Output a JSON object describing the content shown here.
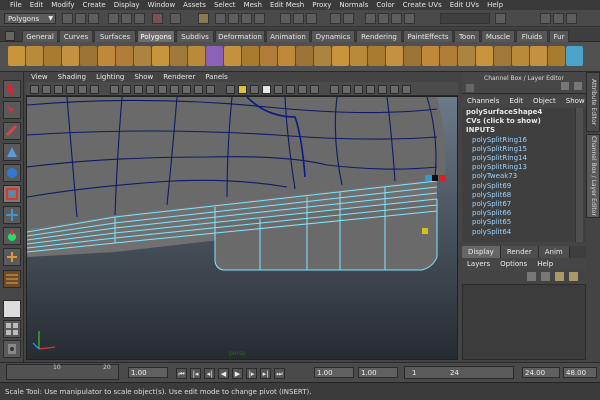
{
  "menubar": {
    "items": [
      "File",
      "Edit",
      "Modify",
      "Create",
      "Display",
      "Window",
      "Assets",
      "Select",
      "Mesh",
      "Edit Mesh",
      "Proxy",
      "Normals",
      "Color",
      "Create UVs",
      "Edit UVs",
      "Help"
    ]
  },
  "status_line": {
    "mode_selector": "Polygons"
  },
  "shelf_tabs": [
    {
      "label": "General",
      "active": false
    },
    {
      "label": "Curves",
      "active": false
    },
    {
      "label": "Surfaces",
      "active": false
    },
    {
      "label": "Polygons",
      "active": true
    },
    {
      "label": "Subdivs",
      "active": false
    },
    {
      "label": "Deformation",
      "active": false
    },
    {
      "label": "Animation",
      "active": false
    },
    {
      "label": "Dynamics",
      "active": false
    },
    {
      "label": "Rendering",
      "active": false
    },
    {
      "label": "PaintEffects",
      "active": false
    },
    {
      "label": "Toon",
      "active": false
    },
    {
      "label": "Muscle",
      "active": false
    },
    {
      "label": "Fluids",
      "active": false
    },
    {
      "label": "Fur",
      "active": false
    }
  ],
  "panel_menu": [
    "View",
    "Shading",
    "Lighting",
    "Show",
    "Renderer",
    "Panels"
  ],
  "channel_box": {
    "title": "Channel Box / Layer Editor",
    "menu": [
      "Channels",
      "Edit",
      "Object",
      "Show"
    ],
    "lines": [
      {
        "text": "polySurfaceShape4",
        "type": "head"
      },
      {
        "text": "CVs (click to show)",
        "type": "head"
      },
      {
        "text": "INPUTS",
        "type": "head"
      },
      {
        "text": "polySplitRing16",
        "type": "indent"
      },
      {
        "text": "polySplitRing15",
        "type": "indent"
      },
      {
        "text": "polySplitRing14",
        "type": "indent"
      },
      {
        "text": "polySplitRing13",
        "type": "indent"
      },
      {
        "text": "polyTweak73",
        "type": "indent"
      },
      {
        "text": "polySplit69",
        "type": "indent"
      },
      {
        "text": "polySplit68",
        "type": "indent"
      },
      {
        "text": "polySplit67",
        "type": "indent"
      },
      {
        "text": "polySplit66",
        "type": "indent"
      },
      {
        "text": "polySplit65",
        "type": "indent"
      },
      {
        "text": "polySplit64",
        "type": "indent"
      }
    ]
  },
  "side_tabs": {
    "attribute_editor": "Attribute Editor",
    "channel_box": "Channel Box / Layer Editor"
  },
  "layer_editor": {
    "tabs": [
      {
        "label": "Display",
        "active": true
      },
      {
        "label": "Render",
        "active": false
      },
      {
        "label": "Anim",
        "active": false
      }
    ],
    "menu": [
      "Layers",
      "Options",
      "Help"
    ]
  },
  "timeline": {
    "ticks": [
      "10",
      "20"
    ],
    "start_field": "1.00",
    "current_frame": "1.00",
    "range_start": "1.00",
    "range_field": "1",
    "range_end_inner": "24",
    "end_field": "24.00",
    "end_field2": "48.00"
  },
  "help_line": "Scale Tool: Use manipulator to scale object(s). Use edit mode to change pivot (INSERT).",
  "viewport": {
    "camera_label": "persp"
  },
  "colors": {
    "wire": "#0a1a6b",
    "selection": "#7fe6ff",
    "bg_top": "#5f6d7d",
    "bg_bottom": "#2c3238",
    "mesh": "#6b6b6b"
  }
}
